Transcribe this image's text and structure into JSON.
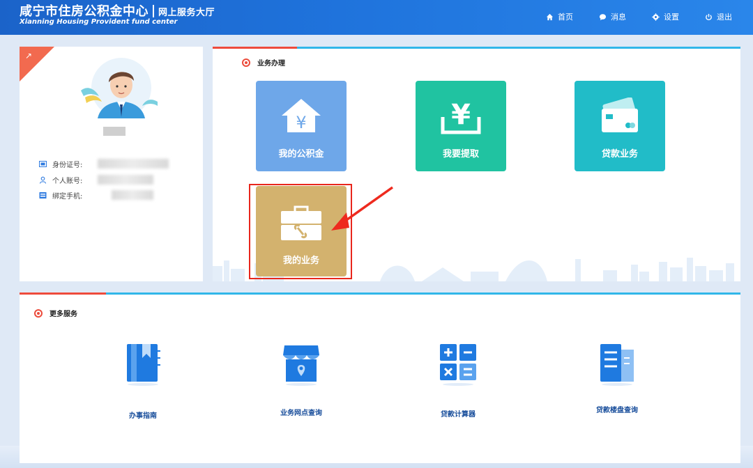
{
  "header": {
    "title": "咸宁市住房公积金中心",
    "subtitle": "网上服务大厅",
    "title_en": "Xianning Housing Provident fund center",
    "nav": [
      {
        "label": "首页",
        "icon": "home-icon"
      },
      {
        "label": "消息",
        "icon": "message-icon"
      },
      {
        "label": "设置",
        "icon": "gear-icon"
      },
      {
        "label": "退出",
        "icon": "power-icon"
      }
    ]
  },
  "profile": {
    "fields": [
      {
        "label": "身份证号:",
        "icon": "id-card-icon"
      },
      {
        "label": "个人账号:",
        "icon": "user-icon"
      },
      {
        "label": "绑定手机:",
        "icon": "phone-icon"
      }
    ]
  },
  "business": {
    "title": "业务办理",
    "tiles": [
      {
        "label": "我的公积金",
        "icon": "house-yuan-icon",
        "color": "#6ea7e9"
      },
      {
        "label": "我要提取",
        "icon": "withdraw-yuan-icon",
        "color": "#20c3a1"
      },
      {
        "label": "贷款业务",
        "icon": "card-icon",
        "color": "#21bcc8"
      },
      {
        "label": "我的业务",
        "icon": "toolbox-icon",
        "color": "#d3b26e"
      }
    ]
  },
  "more": {
    "title": "更多服务",
    "items": [
      {
        "label": "办事指南",
        "icon": "guide-book-icon"
      },
      {
        "label": "业务网点查询",
        "icon": "branch-store-icon"
      },
      {
        "label": "贷款计算器",
        "icon": "calculator-icon"
      },
      {
        "label": "贷款楼盘查询",
        "icon": "building-icon"
      }
    ]
  },
  "colors": {
    "header_blue": "#1f73dc",
    "accent_red": "#ec4b3b",
    "accent_cyan": "#31b7e9",
    "icon_blue": "#1f7ae0"
  }
}
